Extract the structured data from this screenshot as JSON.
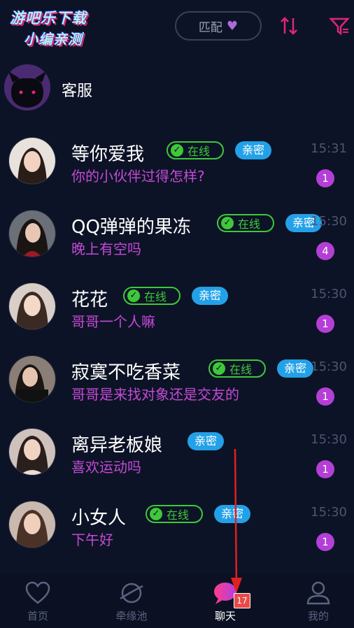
{
  "watermark": {
    "line1": "游吧乐下载",
    "line2": "小编亲测"
  },
  "header": {
    "match_label": "匹配",
    "match_icon": "heart-icon",
    "sort_icon": "sort-icon",
    "filter_icon": "filter-icon"
  },
  "service": {
    "name": "客服"
  },
  "badges": {
    "online": "在线",
    "close": "亲密"
  },
  "chats": [
    {
      "name": "等你爱我",
      "message": "你的小伙伴过得怎样?",
      "time": "15:31",
      "unread": "1",
      "online": true,
      "close": true
    },
    {
      "name": "QQ弹弹的果冻",
      "message": "晚上有空吗",
      "time": "15:30",
      "unread": "4",
      "online": true,
      "close": true
    },
    {
      "name": "花花",
      "message": "哥哥一个人嘛",
      "time": "15:30",
      "unread": "1",
      "online": true,
      "close": true
    },
    {
      "name": "寂寞不吃香菜",
      "message": "哥哥是来找对象还是交友的",
      "time": "15:30",
      "unread": "1",
      "online": true,
      "close": true
    },
    {
      "name": "离异老板娘",
      "message": "喜欢运动吗",
      "time": "15:30",
      "unread": "1",
      "online": false,
      "close": true
    },
    {
      "name": "小女人",
      "message": "下午好",
      "time": "15:30",
      "unread": "1",
      "online": true,
      "close": true
    }
  ],
  "tabbar": {
    "tabs": [
      {
        "label": "首页",
        "icon": "heart-outline-icon"
      },
      {
        "label": "牵缘池",
        "icon": "planet-icon"
      },
      {
        "label": "聊天",
        "icon": "chat-bubble-icon"
      },
      {
        "label": "我的",
        "icon": "person-icon"
      }
    ],
    "chat_badge": "17"
  },
  "colors": {
    "background": "#0d1326",
    "accent": "#c34ad6",
    "online": "#3ec83a",
    "close_badge": "#23a1e8"
  }
}
